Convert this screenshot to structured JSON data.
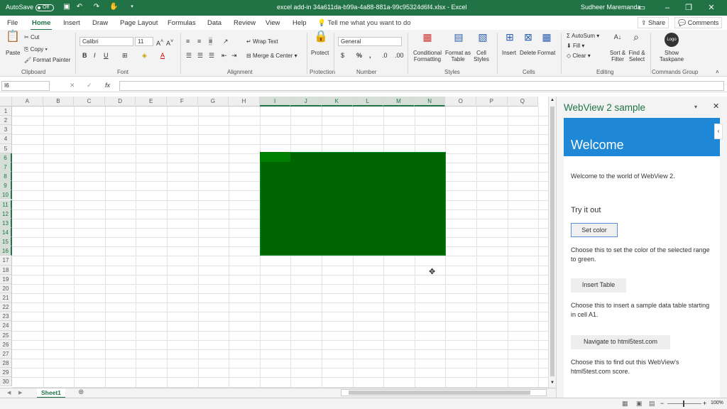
{
  "titlebar": {
    "autosave_label": "AutoSave",
    "autosave_state": "Off",
    "filename": "excel add-in 34a611da-b99a-4a88-881a-99c95324d6f4.xlsx",
    "app_name": "Excel",
    "user_name": "Sudheer Maremanda",
    "bg_color": "#217346"
  },
  "tabs": [
    "File",
    "Home",
    "Insert",
    "Draw",
    "Page Layout",
    "Formulas",
    "Data",
    "Review",
    "View",
    "Help"
  ],
  "active_tab": "Home",
  "tell_me": "Tell me what you want to do",
  "share_label": "Share",
  "comments_label": "Comments",
  "ribbon": {
    "clipboard": {
      "paste": "Paste",
      "cut": "Cut",
      "copy": "Copy",
      "format_painter": "Format Painter",
      "label": "Clipboard"
    },
    "font": {
      "font_name": "Calibri",
      "font_size": "11",
      "label": "Font"
    },
    "alignment": {
      "wrap_text": "Wrap Text",
      "merge_center": "Merge & Center",
      "label": "Alignment"
    },
    "protection": {
      "protect": "Protect",
      "label": "Protection"
    },
    "number": {
      "format": "General",
      "label": "Number"
    },
    "styles": {
      "conditional_formatting": "Conditional Formatting",
      "format_as_table": "Format as Table",
      "cell_styles": "Cell Styles",
      "label": "Styles"
    },
    "cells": {
      "insert": "Insert",
      "delete": "Delete",
      "format": "Format",
      "label": "Cells"
    },
    "editing": {
      "autosum": "AutoSum",
      "fill": "Fill",
      "clear": "Clear",
      "sort_filter": "Sort & Filter",
      "find_select": "Find & Select",
      "label": "Editing"
    },
    "commands": {
      "logo": "Logo",
      "show_taskpane": "Show Taskpane",
      "label": "Commands Group"
    }
  },
  "formula_bar": {
    "name_box": "I6",
    "fx": "fx",
    "formula": ""
  },
  "columns": [
    "A",
    "B",
    "C",
    "D",
    "E",
    "F",
    "G",
    "H",
    "I",
    "J",
    "K",
    "L",
    "M",
    "N",
    "O",
    "P",
    "Q"
  ],
  "rows": [
    "1",
    "2",
    "3",
    "4",
    "5",
    "6",
    "7",
    "8",
    "9",
    "10",
    "11",
    "12",
    "13",
    "14",
    "15",
    "16",
    "17",
    "18",
    "19",
    "20",
    "21",
    "22",
    "23",
    "24",
    "25",
    "26",
    "27",
    "28",
    "29",
    "30"
  ],
  "selection": {
    "range": "I6:N16",
    "fill_color": "#006400"
  },
  "sheet_tab": "Sheet1",
  "zoom": "100%",
  "taskpane": {
    "title": "WebView 2 sample",
    "welcome": "Welcome",
    "welcome_text": "Welcome to the world of WebView 2.",
    "try_it_out": "Try it out",
    "set_color_btn": "Set color",
    "set_color_desc": "Choose this to set the color of the selected range to green.",
    "insert_table_btn": "Insert Table",
    "insert_table_desc": "Choose this to insert a sample data table starting in cell A1.",
    "navigate_btn": "Navigate to html5test.com",
    "navigate_desc": "Choose this to find out this WebView's html5test.com score.",
    "accent_color": "#1e88d6"
  }
}
